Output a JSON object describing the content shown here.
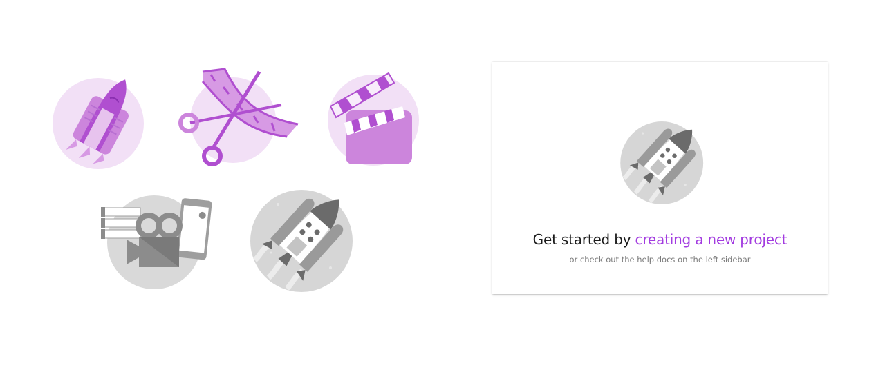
{
  "empty_state": {
    "headline_prefix": "Get started by",
    "headline_link": "creating a new project",
    "subtext": "or check out the help docs on the left sidebar"
  },
  "illustrations": [
    {
      "icon": "rocket-purple-icon",
      "color": "#b04fd0"
    },
    {
      "icon": "scissors-film-purple-icon",
      "color": "#b04fd0"
    },
    {
      "icon": "clapperboard-purple-icon",
      "color": "#b04fd0"
    },
    {
      "icon": "video-camera-phone-gray-icon",
      "color": "#8c8c8c"
    },
    {
      "icon": "rocket-gray-icon",
      "color": "#8c8c8c"
    }
  ],
  "colors": {
    "accent": "#a23be0",
    "circle_purple": "#f2e0f6",
    "circle_gray": "#d9d9d9"
  }
}
